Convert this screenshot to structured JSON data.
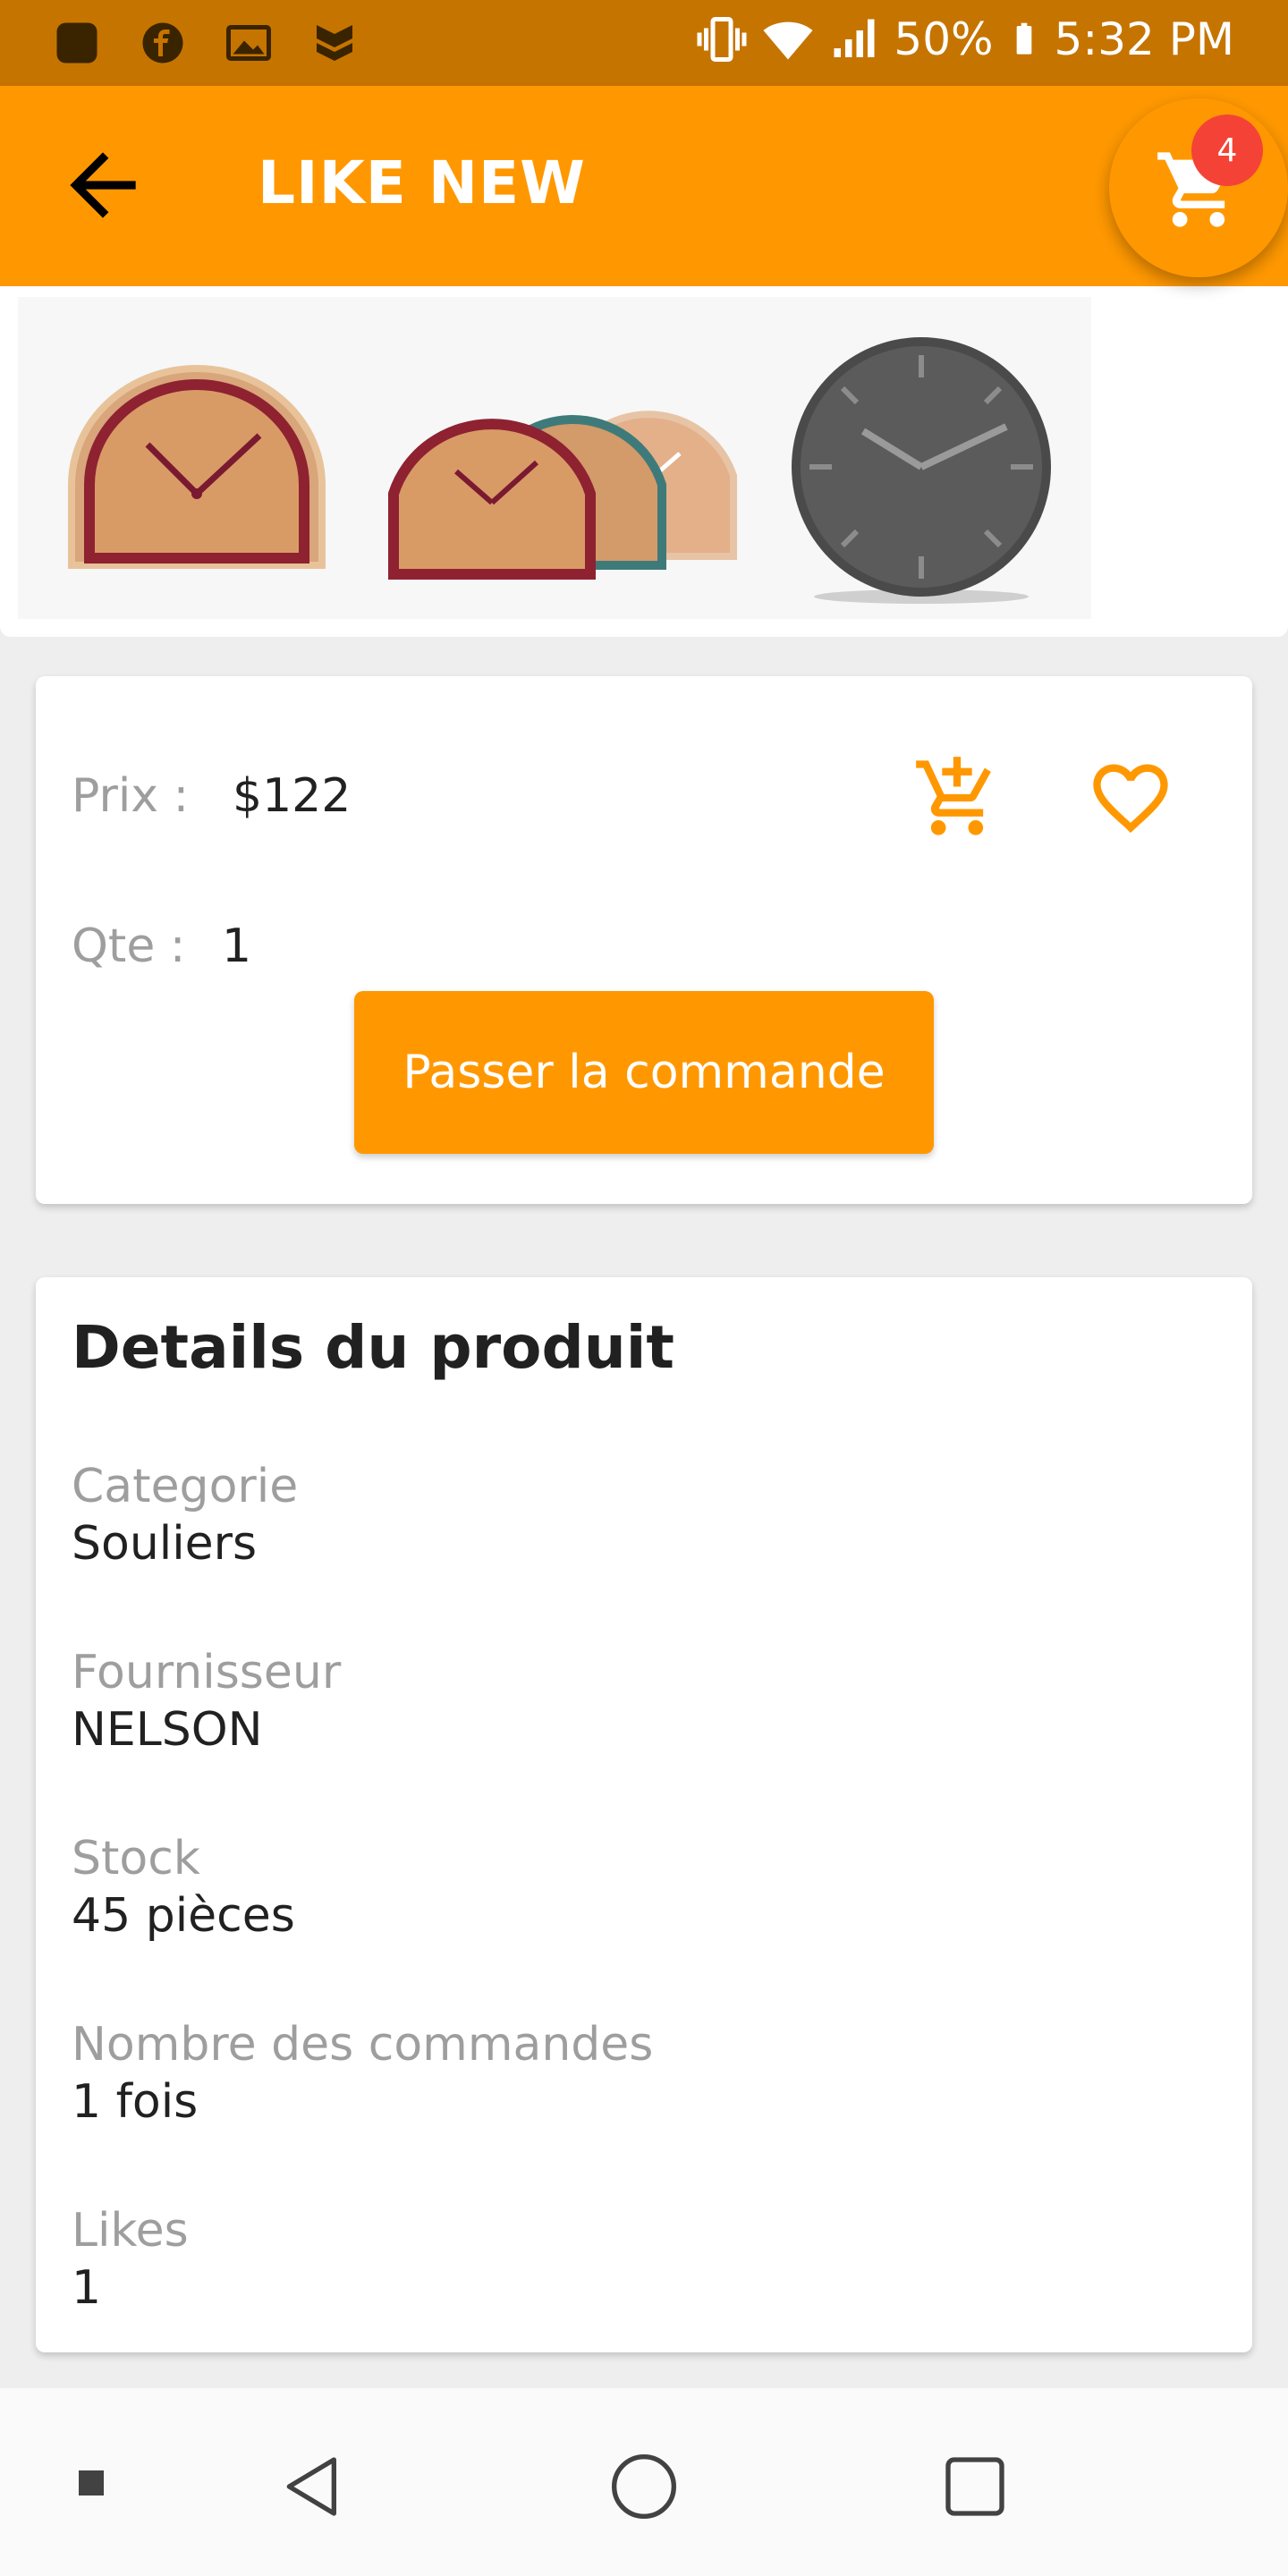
{
  "status_bar": {
    "battery": "50%",
    "time": "5:32 PM"
  },
  "toolbar": {
    "title": "LIKE NEW",
    "cart_count": "4"
  },
  "product": {
    "price_label": "Prix :",
    "price_value": "$122",
    "qty_label": "Qte :",
    "qty_value": "1",
    "order_button": "Passer la commande"
  },
  "details": {
    "heading": "Details du produit",
    "items": [
      {
        "label": "Categorie",
        "value": "Souliers"
      },
      {
        "label": "Fournisseur",
        "value": "NELSON"
      },
      {
        "label": "Stock",
        "value": "45 pièces"
      },
      {
        "label": "Nombre des commandes",
        "value": "1 fois"
      },
      {
        "label": "Likes",
        "value": "1"
      }
    ]
  },
  "colors": {
    "accent": "#ff9800",
    "status_bar": "#c67400",
    "badge": "#f44336"
  },
  "icons": {
    "back": "arrow-back-icon",
    "cart": "cart-icon",
    "add_to_cart": "add-cart-icon",
    "favorite": "heart-outline-icon"
  }
}
